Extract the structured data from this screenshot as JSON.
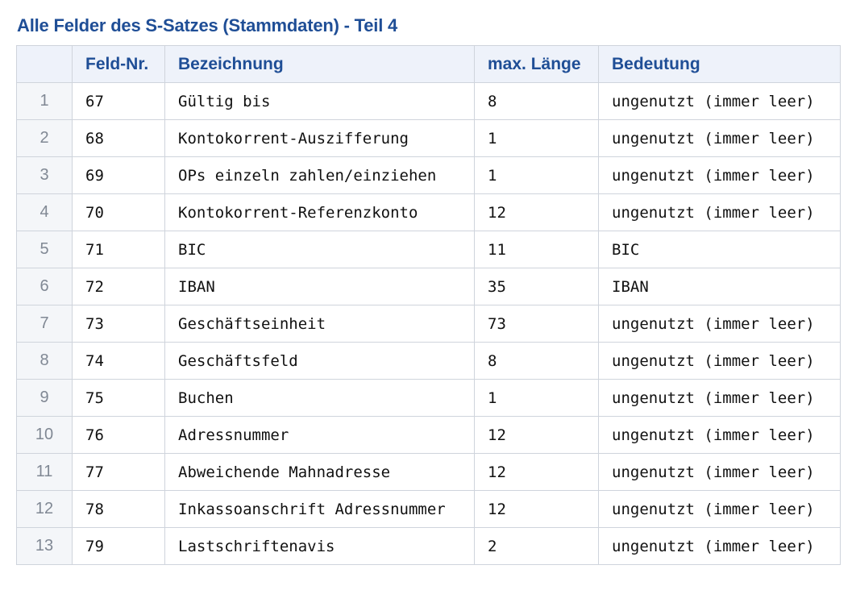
{
  "title": "Alle Felder des S-Satzes (Stammdaten) - Teil 4",
  "columns": [
    "",
    "Feld-Nr.",
    "Bezeichnung",
    "max. Länge",
    "Bedeutung"
  ],
  "rows": [
    {
      "index": "1",
      "feld_nr": "67",
      "bezeichnung": "Gültig bis",
      "max_laenge": "8",
      "bedeutung": "ungenutzt (immer leer)"
    },
    {
      "index": "2",
      "feld_nr": "68",
      "bezeichnung": "Kontokorrent-Auszifferung",
      "max_laenge": "1",
      "bedeutung": "ungenutzt (immer leer)"
    },
    {
      "index": "3",
      "feld_nr": "69",
      "bezeichnung": "OPs einzeln zahlen/einziehen",
      "max_laenge": "1",
      "bedeutung": "ungenutzt (immer leer)"
    },
    {
      "index": "4",
      "feld_nr": "70",
      "bezeichnung": "Kontokorrent-Referenzkonto",
      "max_laenge": "12",
      "bedeutung": "ungenutzt (immer leer)"
    },
    {
      "index": "5",
      "feld_nr": "71",
      "bezeichnung": "BIC",
      "max_laenge": "11",
      "bedeutung": "BIC"
    },
    {
      "index": "6",
      "feld_nr": "72",
      "bezeichnung": "IBAN",
      "max_laenge": "35",
      "bedeutung": "IBAN"
    },
    {
      "index": "7",
      "feld_nr": "73",
      "bezeichnung": "Geschäftseinheit",
      "max_laenge": "73",
      "bedeutung": "ungenutzt (immer leer)"
    },
    {
      "index": "8",
      "feld_nr": "74",
      "bezeichnung": "Geschäftsfeld",
      "max_laenge": "8",
      "bedeutung": "ungenutzt (immer leer)"
    },
    {
      "index": "9",
      "feld_nr": "75",
      "bezeichnung": "Buchen",
      "max_laenge": "1",
      "bedeutung": "ungenutzt (immer leer)"
    },
    {
      "index": "10",
      "feld_nr": "76",
      "bezeichnung": "Adressnummer",
      "max_laenge": "12",
      "bedeutung": "ungenutzt (immer leer)"
    },
    {
      "index": "11",
      "feld_nr": "77",
      "bezeichnung": "Abweichende Mahnadresse",
      "max_laenge": "12",
      "bedeutung": "ungenutzt (immer leer)"
    },
    {
      "index": "12",
      "feld_nr": "78",
      "bezeichnung": "Inkassoanschrift Adressnummer",
      "max_laenge": "12",
      "bedeutung": "ungenutzt (immer leer)"
    },
    {
      "index": "13",
      "feld_nr": "79",
      "bezeichnung": "Lastschriftenavis",
      "max_laenge": "2",
      "bedeutung": "ungenutzt (immer leer)"
    }
  ]
}
